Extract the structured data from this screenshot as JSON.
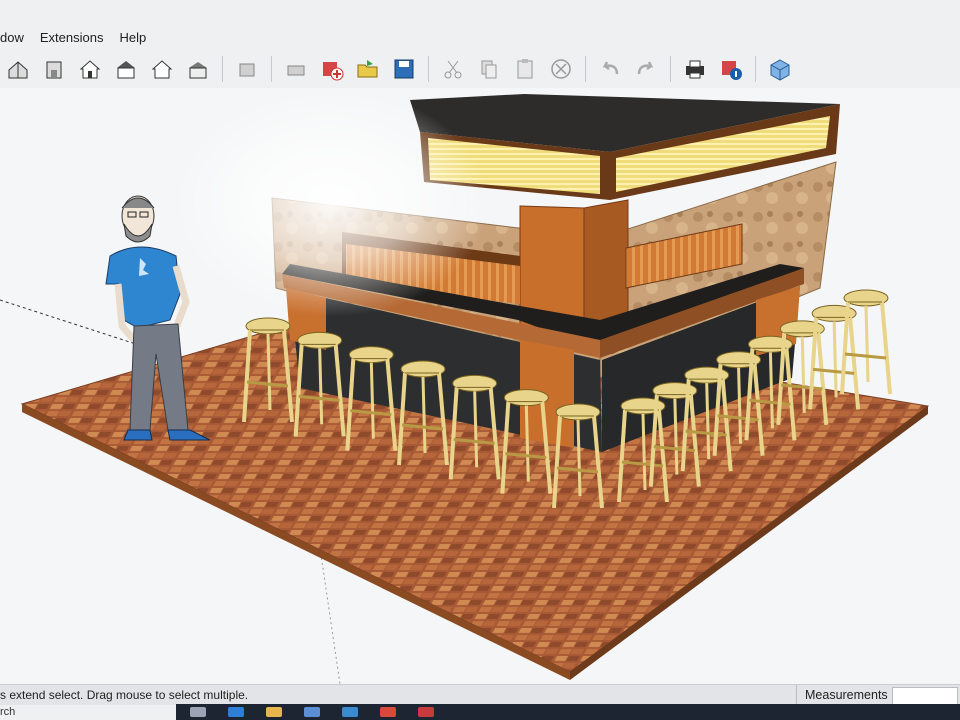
{
  "menu": {
    "items": [
      {
        "name": "menu-window",
        "label": "dow"
      },
      {
        "name": "menu-extensions",
        "label": "Extensions"
      },
      {
        "name": "menu-help",
        "label": "Help"
      }
    ]
  },
  "toolbar": {
    "groups": [
      [
        "house-iso-icon",
        "house-front-icon",
        "house-top-icon",
        "house-right-icon",
        "house-back-icon",
        "house-left-icon"
      ],
      [
        "component-icon"
      ],
      [
        "printer-icon",
        "add-model-icon",
        "open-folder-icon",
        "save-disk-icon"
      ],
      [
        "scissors-icon",
        "copy-icon",
        "paste-icon",
        "erase-icon"
      ],
      [
        "undo-icon",
        "redo-icon"
      ],
      [
        "print-icon",
        "model-info-icon"
      ],
      [
        "cube-icon"
      ]
    ]
  },
  "scene": {
    "floor_color": "#b0643a",
    "counter_color": "#2b2a28",
    "wood_color": "#c8702e",
    "stool_color": "#e8d48a",
    "stool_count": 15
  },
  "status": {
    "hint": "s extend select. Drag mouse to select multiple.",
    "measurements_label": "Measurements",
    "search_stub": "rch"
  }
}
